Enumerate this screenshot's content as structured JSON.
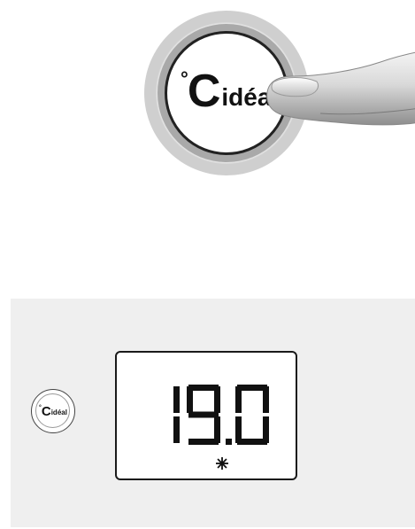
{
  "hero": {
    "button": {
      "degree_symbol": "°",
      "letter": "C",
      "word": "idéa"
    }
  },
  "panel": {
    "button": {
      "degree_symbol": "°",
      "letter": "C",
      "word": "idéal"
    },
    "display": {
      "temperature": "19.0",
      "mode_icon": "sun-icon"
    }
  },
  "colors": {
    "panel_bg": "#efefef",
    "lcd_border": "#1a1a1a",
    "ring_grey": "#a9a9a9"
  }
}
